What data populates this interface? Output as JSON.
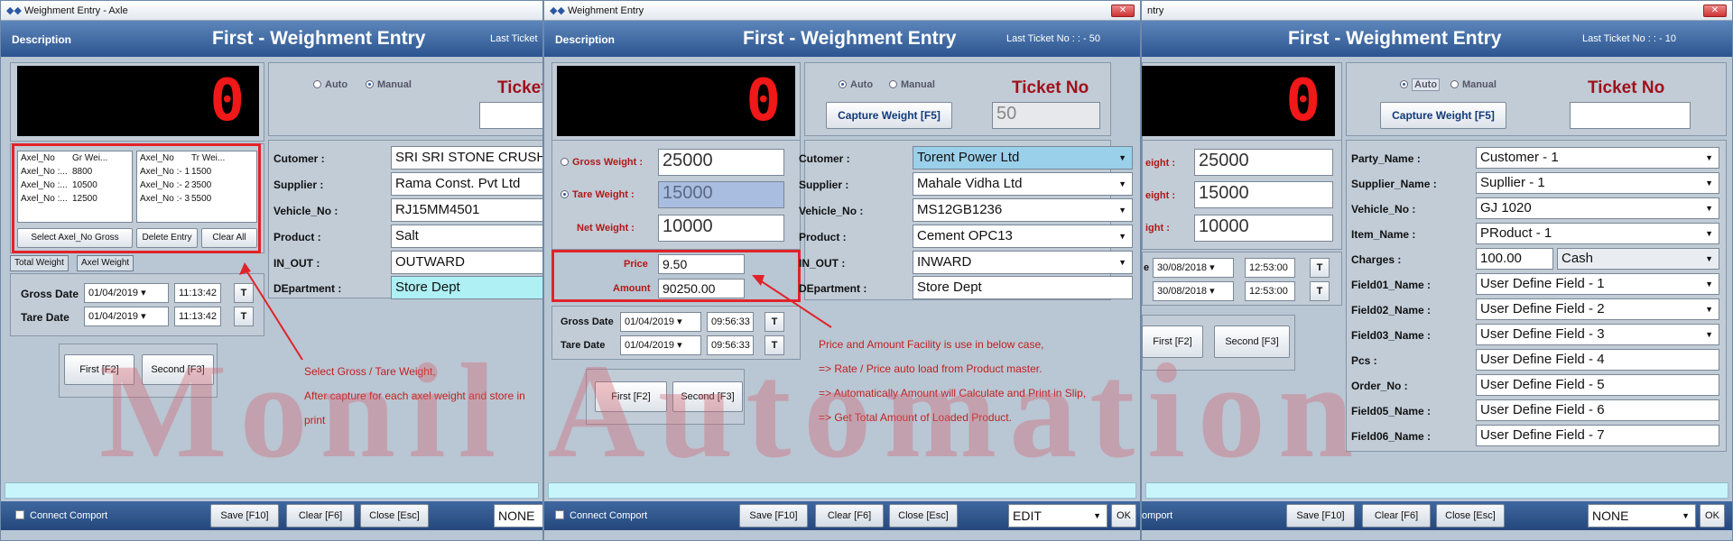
{
  "panel1": {
    "title": "Weighment Entry - Axle",
    "description": "Description",
    "header_title": "First - Weighment Entry",
    "last_ticket": "Last Ticket",
    "display": "0",
    "radio_auto": "Auto",
    "radio_manual": "Manual",
    "ticket_label": "Ticket",
    "axle_table_left": {
      "headers": [
        "Axel_No",
        "Gr Wei..."
      ],
      "rows": [
        [
          "Axel_No :...",
          "8800"
        ],
        [
          "Axel_No :...",
          "10500"
        ],
        [
          "Axel_No :...",
          "12500"
        ]
      ]
    },
    "axle_table_right": {
      "headers": [
        "Axel_No",
        "Tr Wei..."
      ],
      "rows": [
        [
          "Axel_No :- 1",
          "1500"
        ],
        [
          "Axel_No :- 2",
          "3500"
        ],
        [
          "Axel_No :- 3",
          "5500"
        ]
      ]
    },
    "btn_select": "Select Axel_No Gross",
    "btn_delete": "Delete Entry",
    "btn_clear_all": "Clear All",
    "tab_total": "Total Weight",
    "tab_axel": "Axel Weight",
    "gross_date_label": "Gross Date",
    "gross_date": "01/04/2019",
    "gross_time": "11:13:42",
    "tare_date_label": "Tare Date",
    "tare_date": "01/04/2019",
    "tare_time": "11:13:42",
    "t_btn": "T",
    "first_btn": "First [F2]",
    "second_btn": "Second [F3]",
    "fields": [
      {
        "label": "Cutomer :",
        "value": "SRI SRI STONE CRUSHER"
      },
      {
        "label": "Supplier :",
        "value": "Rama Const. Pvt Ltd"
      },
      {
        "label": "Vehicle_No :",
        "value": "RJ15MM4501"
      },
      {
        "label": "Product :",
        "value": "Salt"
      },
      {
        "label": "IN_OUT :",
        "value": "OUTWARD"
      },
      {
        "label": "DEpartment :",
        "value": "Store Dept"
      }
    ],
    "note_lines": [
      "Select Gross / Tare Weight,",
      "After capture for each axel weight and store in",
      "print"
    ],
    "connect": "Connect Comport",
    "save": "Save [F10]",
    "clear": "Clear [F6]",
    "close": "Close [Esc]",
    "mode": "NONE"
  },
  "panel2": {
    "title": "Weighment Entry",
    "description": "Description",
    "header_title": "First - Weighment Entry",
    "last_ticket": "Last Ticket No : : - 50",
    "display": "0",
    "radio_auto": "Auto",
    "radio_manual": "Manual",
    "ticket_label": "Ticket No",
    "capture_btn": "Capture Weight [F5]",
    "ticket_value": "50",
    "gross_label": "Gross Weight :",
    "gross_value": "25000",
    "tare_label": "Tare Weight :",
    "tare_value": "15000",
    "net_label": "Net Weight :",
    "net_value": "10000",
    "price_label": "Price",
    "price_value": "9.50",
    "amount_label": "Amount",
    "amount_value": "90250.00",
    "gross_date_label": "Gross Date",
    "gross_date": "01/04/2019",
    "gross_time": "09:56:33",
    "tare_date_label": "Tare Date",
    "tare_date": "01/04/2019",
    "tare_time": "09:56:33",
    "t_btn": "T",
    "first_btn": "First [F2]",
    "second_btn": "Second [F3]",
    "fields": [
      {
        "label": "Cutomer :",
        "value": "Torent Power Ltd"
      },
      {
        "label": "Supplier :",
        "value": "Mahale Vidha Ltd"
      },
      {
        "label": "Vehicle_No :",
        "value": "MS12GB1236"
      },
      {
        "label": "Product :",
        "value": "Cement OPC13"
      },
      {
        "label": "IN_OUT :",
        "value": "INWARD"
      },
      {
        "label": "DEpartment :",
        "value": "Store Dept"
      }
    ],
    "note_lines": [
      "Price and Amount Facility is use in below case,",
      "=> Rate / Price auto load from Product master.",
      "=> Automatically Amount will Calculate and Print in Slip,",
      "=> Get Total Amount of Loaded Product."
    ],
    "connect": "Connect Comport",
    "save": "Save [F10]",
    "clear": "Clear [F6]",
    "close": "Close [Esc]",
    "mode": "EDIT",
    "ok": "OK"
  },
  "panel3": {
    "title": "ntry",
    "header_title": "First - Weighment Entry",
    "last_ticket": "Last Ticket No : : - 10",
    "display": "0",
    "radio_auto": "Auto",
    "radio_manual": "Manual",
    "ticket_label": "Ticket No",
    "capture_btn": "Capture Weight [F5]",
    "gross_label": "eight :",
    "gross_value": "25000",
    "tare_label": "eight :",
    "tare_value": "15000",
    "net_label": "ight :",
    "net_value": "10000",
    "gross_date_prefix": "e",
    "gross_date": "30/08/2018",
    "gross_time": "12:53:00",
    "tare_date": "30/08/2018",
    "tare_time": "12:53:00",
    "t_btn": "T",
    "first_btn": "First [F2]",
    "second_btn": "Second [F3]",
    "fields": [
      {
        "label": "Party_Name :",
        "value": "Customer - 1",
        "dd": true
      },
      {
        "label": "Supplier_Name :",
        "value": "Supllier - 1",
        "dd": true
      },
      {
        "label": "Vehicle_No :",
        "value": "GJ 1020",
        "dd": true
      },
      {
        "label": "Item_Name :",
        "value": "PRoduct - 1",
        "dd": true
      },
      {
        "label": "Charges :",
        "value": "100.00",
        "dd": false
      },
      {
        "label": "Field01_Name :",
        "value": "User Define Field - 1",
        "dd": true
      },
      {
        "label": "Field02_Name :",
        "value": "User Define Field - 2",
        "dd": true
      },
      {
        "label": "Field03_Name :",
        "value": "User Define Field - 3",
        "dd": true
      },
      {
        "label": "Pcs :",
        "value": "User Define Field - 4",
        "dd": false
      },
      {
        "label": "Order_No :",
        "value": "User Define Field - 5",
        "dd": false
      },
      {
        "label": "Field05_Name :",
        "value": "User Define Field - 6",
        "dd": false
      },
      {
        "label": "Field06_Name :",
        "value": "User Define Field - 7",
        "dd": false
      }
    ],
    "charges_mode": "Cash",
    "connect": "omport",
    "save": "Save [F10]",
    "clear": "Clear [F6]",
    "close": "Close [Esc]",
    "mode": "NONE",
    "ok": "OK"
  },
  "watermark": "Monil Automation"
}
